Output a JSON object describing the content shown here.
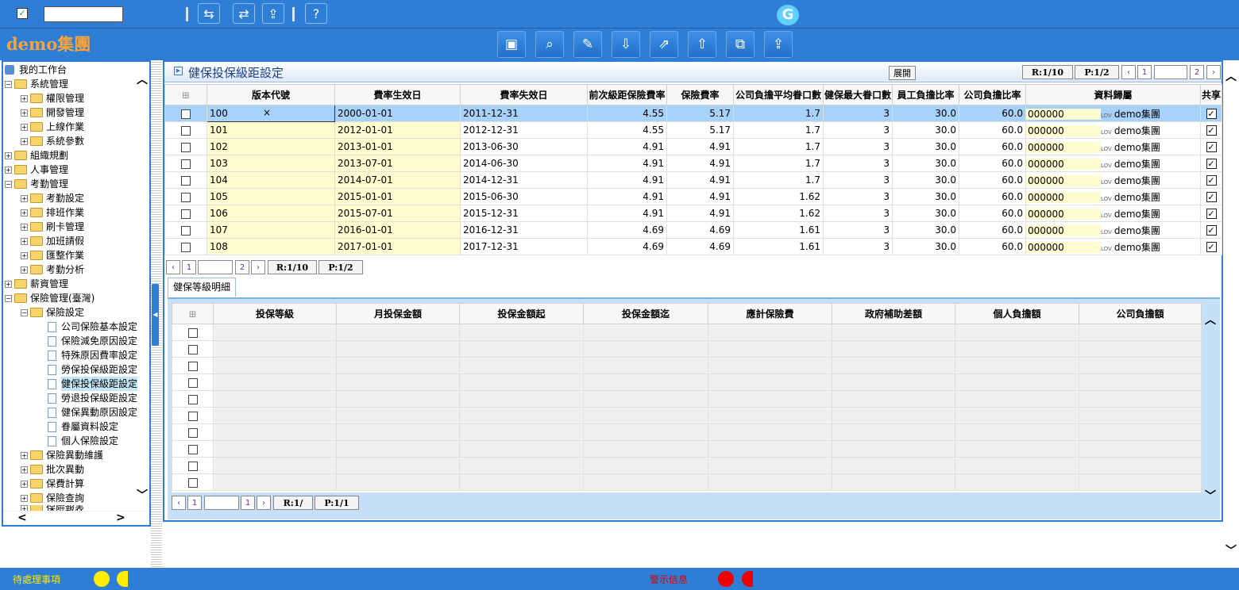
{
  "top": {
    "group_name": "demo集團",
    "checked": "✓"
  },
  "tree": {
    "items": [
      {
        "label": "我的工作台"
      },
      {
        "label": "系統管理"
      },
      {
        "label": "權限管理"
      },
      {
        "label": "開發管理"
      },
      {
        "label": "上線作業"
      },
      {
        "label": "系統參數"
      },
      {
        "label": "組織規劃"
      },
      {
        "label": "人事管理"
      },
      {
        "label": "考勤管理"
      },
      {
        "label": "考勤設定"
      },
      {
        "label": "排班作業"
      },
      {
        "label": "刷卡管理"
      },
      {
        "label": "加班請假"
      },
      {
        "label": "匯整作業"
      },
      {
        "label": "考勤分析"
      },
      {
        "label": "薪資管理"
      },
      {
        "label": "保險管理(臺灣)"
      },
      {
        "label": "保險設定"
      },
      {
        "label": "公司保險基本設定"
      },
      {
        "label": "保險減免原因設定"
      },
      {
        "label": "特殊原因費率設定"
      },
      {
        "label": "勞保投保級距設定"
      },
      {
        "label": "健保投保級距設定"
      },
      {
        "label": "勞退投保級距設定"
      },
      {
        "label": "健保異動原因設定"
      },
      {
        "label": "眷屬資料設定"
      },
      {
        "label": "個人保險設定"
      },
      {
        "label": "保險異動維護"
      },
      {
        "label": "批次異動"
      },
      {
        "label": "保費計算"
      },
      {
        "label": "保險查詢"
      },
      {
        "label": "保險報表"
      }
    ]
  },
  "main": {
    "title": "健保投保級距設定",
    "expand_label": "展開",
    "pager_top": {
      "records": "R:1/10",
      "pages": "P:1/2",
      "page": "1",
      "total": "2"
    },
    "columns": [
      "版本代號",
      "費率生效日",
      "費率失效日",
      "前次級距保險費率",
      "保險費率",
      "公司負擔平均眷口數",
      "健保最大眷口數",
      "員工負擔比率",
      "公司負擔比率",
      "資料歸屬",
      "共享"
    ],
    "clear_mark": "×",
    "lov": "LOV",
    "owner": "demo集團",
    "rows": [
      [
        "100",
        "2000-01-01",
        "2011-12-31",
        "4.55",
        "5.17",
        "1.7",
        "3",
        "30.0",
        "60.0",
        "000000"
      ],
      [
        "101",
        "2012-01-01",
        "2012-12-31",
        "4.55",
        "5.17",
        "1.7",
        "3",
        "30.0",
        "60.0",
        "000000"
      ],
      [
        "102",
        "2013-01-01",
        "2013-06-30",
        "4.91",
        "4.91",
        "1.7",
        "3",
        "30.0",
        "60.0",
        "000000"
      ],
      [
        "103",
        "2013-07-01",
        "2014-06-30",
        "4.91",
        "4.91",
        "1.7",
        "3",
        "30.0",
        "60.0",
        "000000"
      ],
      [
        "104",
        "2014-07-01",
        "2014-12-31",
        "4.91",
        "4.91",
        "1.7",
        "3",
        "30.0",
        "60.0",
        "000000"
      ],
      [
        "105",
        "2015-01-01",
        "2015-06-30",
        "4.91",
        "4.91",
        "1.62",
        "3",
        "30.0",
        "60.0",
        "000000"
      ],
      [
        "106",
        "2015-07-01",
        "2015-12-31",
        "4.91",
        "4.91",
        "1.62",
        "3",
        "30.0",
        "60.0",
        "000000"
      ],
      [
        "107",
        "2016-01-01",
        "2016-12-31",
        "4.69",
        "4.69",
        "1.61",
        "3",
        "30.0",
        "60.0",
        "000000"
      ],
      [
        "108",
        "2017-01-01",
        "2017-12-31",
        "4.69",
        "4.69",
        "1.61",
        "3",
        "30.0",
        "60.0",
        "000000"
      ]
    ],
    "pager_mid": {
      "records": "R:1/10",
      "pages": "P:1/2",
      "page": "1",
      "total": "2"
    },
    "tab_label": "健保等級明細",
    "detail_columns": [
      "投保等級",
      "月投保金額",
      "投保金額起",
      "投保金額迄",
      "應計保險費",
      "政府補助差額",
      "個人負擔額",
      "公司負擔額"
    ],
    "pager_bottom": {
      "records": "R:1/",
      "pages": "P:1/1",
      "page": "1",
      "total": "1"
    }
  },
  "footer": {
    "pending": "待處理事項",
    "alert": "警示信息"
  },
  "colors": {
    "accent": "#2e7ed6",
    "yellow": "#ffee00",
    "red": "#ee0000"
  }
}
